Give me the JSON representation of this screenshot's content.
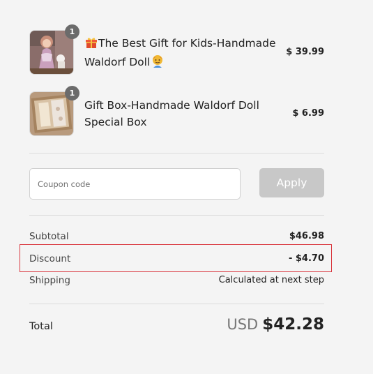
{
  "line_items": [
    {
      "quantity": "1",
      "title": "The Best Gift for Kids-Handmade Waldorf Doll",
      "price": "$ 39.99",
      "leading_icon": "gift-icon",
      "trailing_icon": "child-icon",
      "thumbnail": "waldorf-doll-photo"
    },
    {
      "quantity": "1",
      "title": "Gift Box-Handmade Waldorf Doll Special Box",
      "price": "$ 6.99",
      "thumbnail": "gift-box-photo"
    }
  ],
  "coupon": {
    "placeholder": "Coupon code",
    "value": "",
    "apply_label": "Apply"
  },
  "totals": {
    "subtotal_label": "Subtotal",
    "subtotal_value": "$46.98",
    "discount_label": "Discount",
    "discount_value": "- $4.70",
    "shipping_label": "Shipping",
    "shipping_value": "Calculated at next step",
    "total_label": "Total",
    "total_currency": "USD",
    "total_value": "$42.28"
  },
  "colors": {
    "background": "#f4f4f4",
    "apply_button": "#c8c8c8",
    "quantity_badge": "#6b6b6b",
    "highlight_border": "#d9363e"
  }
}
